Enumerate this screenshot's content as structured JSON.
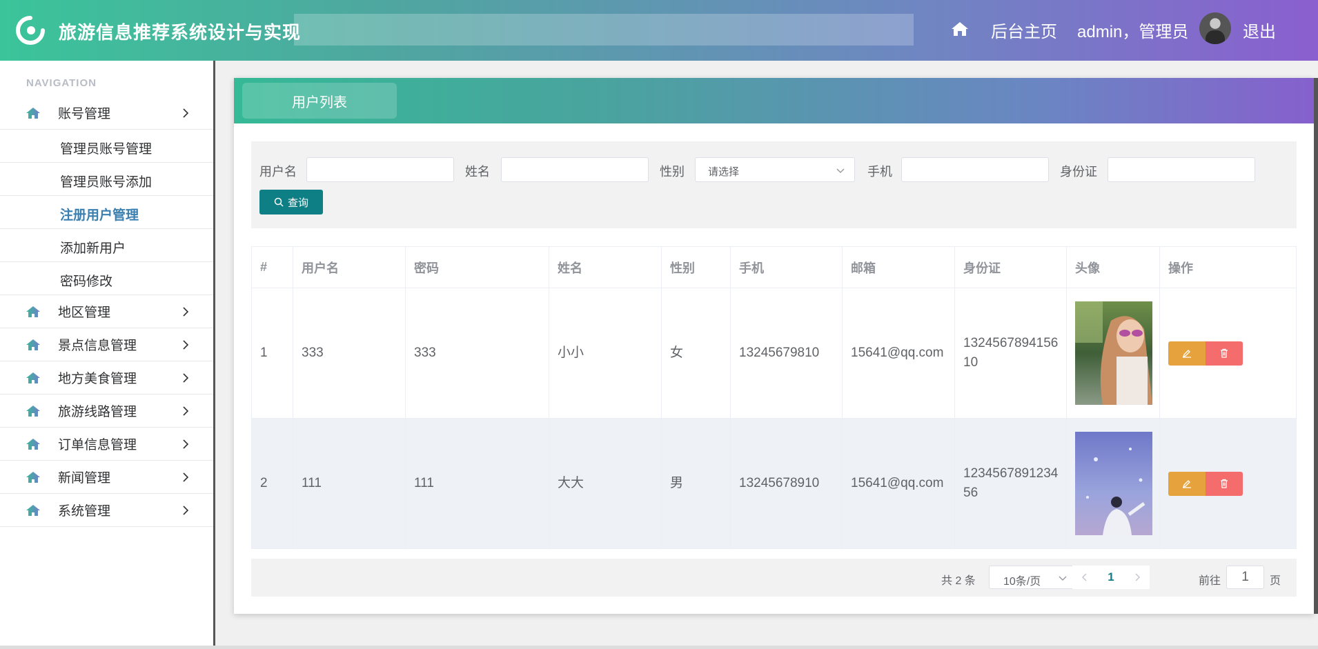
{
  "header": {
    "title": "旅游信息推荐系统设计与实现",
    "home_label": "后台主页",
    "user_label": "admin，管理员",
    "logout_label": "退出",
    "colors": {
      "gradient_start": "#3bc49a",
      "gradient_end": "#8a5fcf"
    }
  },
  "sidebar": {
    "heading": "NAVIGATION",
    "groups": [
      {
        "label": "账号管理",
        "icon": "home-icon",
        "expanded": true,
        "children": [
          {
            "label": "管理员账号管理"
          },
          {
            "label": "管理员账号添加"
          },
          {
            "label": "注册用户管理",
            "active": true
          },
          {
            "label": "添加新用户"
          },
          {
            "label": "密码修改"
          }
        ]
      },
      {
        "label": "地区管理",
        "icon": "home-icon"
      },
      {
        "label": "景点信息管理",
        "icon": "home-icon"
      },
      {
        "label": "地方美食管理",
        "icon": "home-icon"
      },
      {
        "label": "旅游线路管理",
        "icon": "home-icon"
      },
      {
        "label": "订单信息管理",
        "icon": "home-icon"
      },
      {
        "label": "新闻管理",
        "icon": "home-icon"
      },
      {
        "label": "系统管理",
        "icon": "home-icon"
      }
    ]
  },
  "main": {
    "tab_label": "用户列表",
    "filters": {
      "username_label": "用户名",
      "name_label": "姓名",
      "gender_label": "性别",
      "gender_placeholder": "请选择",
      "phone_label": "手机",
      "idcard_label": "身份证",
      "search_button": "查询"
    },
    "table": {
      "columns": [
        "#",
        "用户名",
        "密码",
        "姓名",
        "性别",
        "手机",
        "邮箱",
        "身份证",
        "头像",
        "操作"
      ],
      "rows": [
        {
          "index": "1",
          "username": "333",
          "password": "333",
          "name": "小小",
          "gender": "女",
          "phone": "13245679810",
          "email": "15641@qq.com",
          "idcard": "132456789415610",
          "avatar": "photo-girl-sunglasses"
        },
        {
          "index": "2",
          "username": "111",
          "password": "111",
          "name": "大大",
          "gender": "男",
          "phone": "13245678910",
          "email": "15641@qq.com",
          "idcard": "123456789123456",
          "avatar": "photo-sky-person"
        }
      ]
    },
    "pagination": {
      "total_text": "共 2 条",
      "page_size": "10条/页",
      "current_page": "1",
      "goto_label": "前往",
      "goto_value": "1",
      "page_suffix": "页"
    },
    "colors": {
      "accent": "#0f7f86",
      "edit": "#e6a23c",
      "delete": "#f56c6c",
      "active_menu": "#3a7fb0"
    }
  }
}
